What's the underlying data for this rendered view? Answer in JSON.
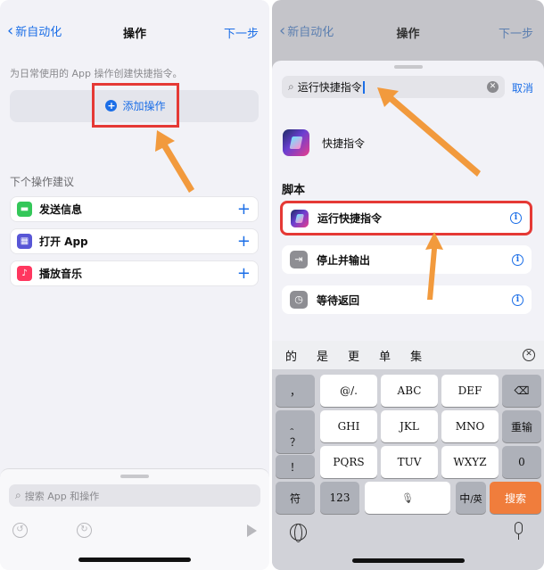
{
  "left": {
    "nav": {
      "back": "新自动化",
      "title": "操作",
      "next": "下一步"
    },
    "hint": "为日常使用的 App 操作创建快捷指令。",
    "add_action": {
      "icon": "plus-circle-icon",
      "label": "添加操作"
    },
    "suggestions_title": "下个操作建议",
    "suggestions": [
      {
        "label": "发送信息",
        "icon": "messages-icon",
        "color": "#34c759"
      },
      {
        "label": "打开 App",
        "icon": "app-grid-icon",
        "color": "#5856d6"
      },
      {
        "label": "播放音乐",
        "icon": "music-icon",
        "color": "#ff375f"
      }
    ],
    "search_placeholder": "搜索 App 和操作"
  },
  "right": {
    "nav": {
      "back": "新自动化",
      "title": "操作",
      "next": "下一步"
    },
    "search_value": "运行快捷指令",
    "cancel": "取消",
    "app_result": "快捷指令",
    "section_title": "脚本",
    "items": [
      {
        "label": "运行快捷指令",
        "icon": "shortcuts-icon"
      },
      {
        "label": "停止并输出",
        "icon": "exit-icon"
      },
      {
        "label": "等待返回",
        "icon": "clock-icon"
      }
    ],
    "candidates": [
      "的",
      "是",
      "更",
      "单",
      "集"
    ],
    "keyboard": {
      "punct": [
        "，",
        "。",
        "？",
        "！"
      ],
      "row1": [
        "@/.",
        "ABC",
        "DEF"
      ],
      "row2": [
        "GHI",
        "JKL",
        "MNO"
      ],
      "row3": [
        "PQRS",
        "TUV",
        "WXYZ"
      ],
      "reenter": "重输",
      "zero": "0",
      "symbol": "符",
      "num": "123",
      "lang_main": "中",
      "lang_sub": "/英",
      "search": "搜索"
    }
  },
  "accent": "#1b6ee7",
  "highlight_color": "#e53935",
  "arrow_color": "#f29a3d"
}
